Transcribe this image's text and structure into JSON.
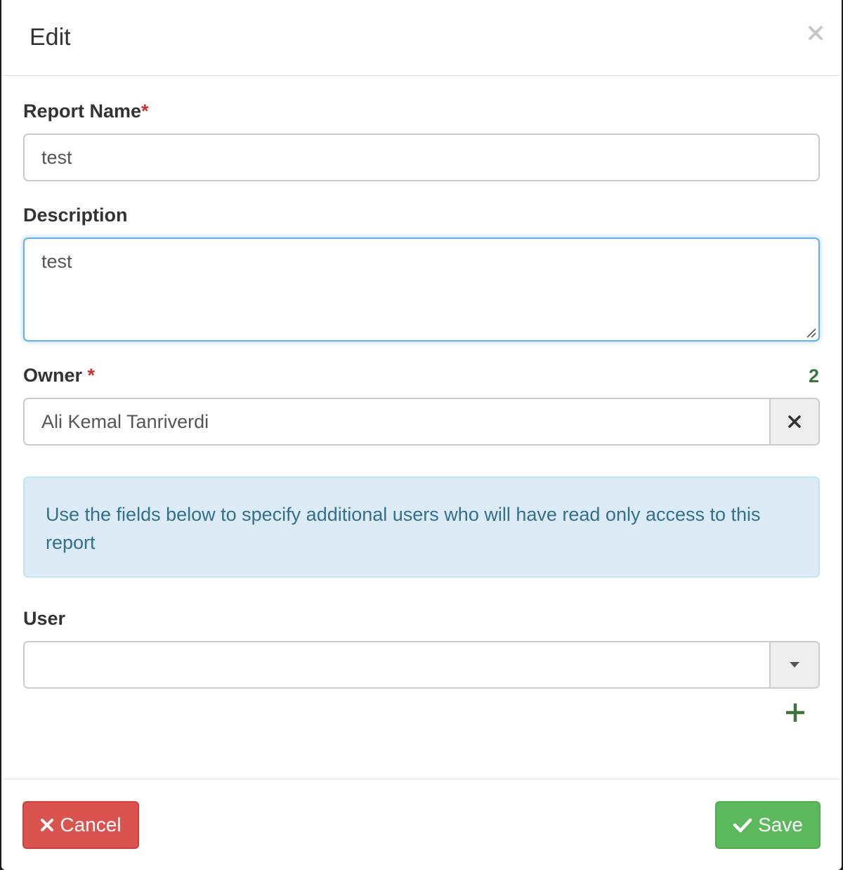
{
  "dialog": {
    "title": "Edit",
    "close_icon": "close-icon"
  },
  "form": {
    "report_name": {
      "label": "Report Name",
      "required_mark": "*",
      "value": "test"
    },
    "description": {
      "label": "Description",
      "value": "test"
    },
    "owner": {
      "label": "Owner",
      "required_mark": "*",
      "count": "2",
      "value": "Ali Kemal Tanriverdi",
      "clear_icon": "clear-icon"
    },
    "info_text": "Use the fields below to specify additional users who will have read only access to this report",
    "user": {
      "label": "User",
      "value": "",
      "dropdown_icon": "caret-down-icon",
      "add_icon": "plus-icon"
    }
  },
  "footer": {
    "cancel_label": "Cancel",
    "cancel_icon": "x-icon",
    "save_label": "Save",
    "save_icon": "check-icon"
  },
  "colors": {
    "required": "#c9302c",
    "count": "#3c763d",
    "info_text": "#31708f",
    "info_bg": "#dcebf6",
    "cancel_bg": "#d9534f",
    "save_bg": "#5cb85c"
  }
}
